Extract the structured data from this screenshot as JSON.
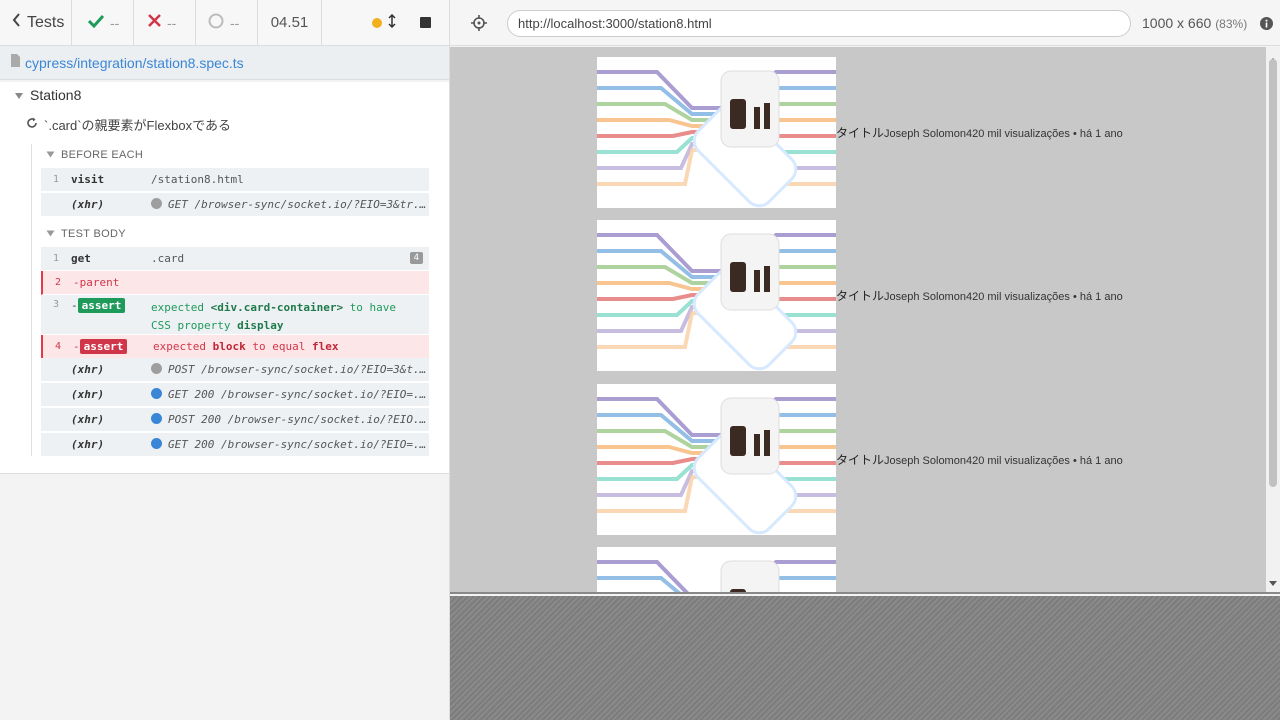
{
  "topbar": {
    "tests_label": "Tests",
    "passed": "--",
    "failed": "--",
    "pending": "--",
    "duration": "04.51"
  },
  "spec": {
    "path": "cypress/integration/station8.spec.ts"
  },
  "suite": {
    "title": "Station8",
    "test_title": "`.card`の親要素がFlexboxである",
    "before_each_label": "BEFORE EACH",
    "test_body_label": "TEST BODY",
    "before_each": [
      {
        "num": "1",
        "name": "visit",
        "message": "/station8.html"
      },
      {
        "num": "",
        "name": "(xhr)",
        "message": "GET /browser-sync/socket.io/?EIO=3&tr..."
      }
    ],
    "body": [
      {
        "num": "1",
        "name": "get",
        "message": ".card",
        "count": "4"
      },
      {
        "num": "2",
        "name": "-parent",
        "message": ""
      },
      {
        "num": "3",
        "name": "-",
        "badge": "assert",
        "msg_prefix": "expected",
        "msg_el": "<div.card-container>",
        "msg_mid": "to have",
        "msg_line2a": "CSS property",
        "msg_line2b": "display"
      },
      {
        "num": "4",
        "name": "-",
        "badge": "assert",
        "msg_prefix": "expected",
        "msg_v1": "block",
        "msg_mid": "to equal",
        "msg_v2": "flex"
      },
      {
        "num": "",
        "name": "(xhr)",
        "message": "POST /browser-sync/socket.io/?EIO=3&t..."
      },
      {
        "num": "",
        "name": "(xhr)",
        "message": "GET 200 /browser-sync/socket.io/?EIO=..."
      },
      {
        "num": "",
        "name": "(xhr)",
        "message": "POST 200 /browser-sync/socket.io/?EIO..."
      },
      {
        "num": "",
        "name": "(xhr)",
        "message": "GET 200 /browser-sync/socket.io/?EIO=..."
      }
    ]
  },
  "aut": {
    "url": "http://localhost:3000/station8.html",
    "viewport": "1000 x 660",
    "scale": "(83%)"
  },
  "cards": [
    {
      "title": "タイトル",
      "author": "Joseph Solomon",
      "views": "420 mil visualizações",
      "sep": "•",
      "age": "há 1 ano"
    },
    {
      "title": "タイトル",
      "author": "Joseph Solomon",
      "views": "420 mil visualizações",
      "sep": "•",
      "age": "há 1 ano"
    },
    {
      "title": "タイトル",
      "author": "Joseph Solomon",
      "views": "420 mil visualizações",
      "sep": "•",
      "age": "há 1 ano"
    },
    {
      "title": "",
      "author": "",
      "views": "",
      "sep": "",
      "age": ""
    }
  ],
  "colors": {
    "accent": "#3a86d6",
    "pass": "#1e9a5a",
    "fail": "#d0364a",
    "running": "#f2b01e"
  }
}
